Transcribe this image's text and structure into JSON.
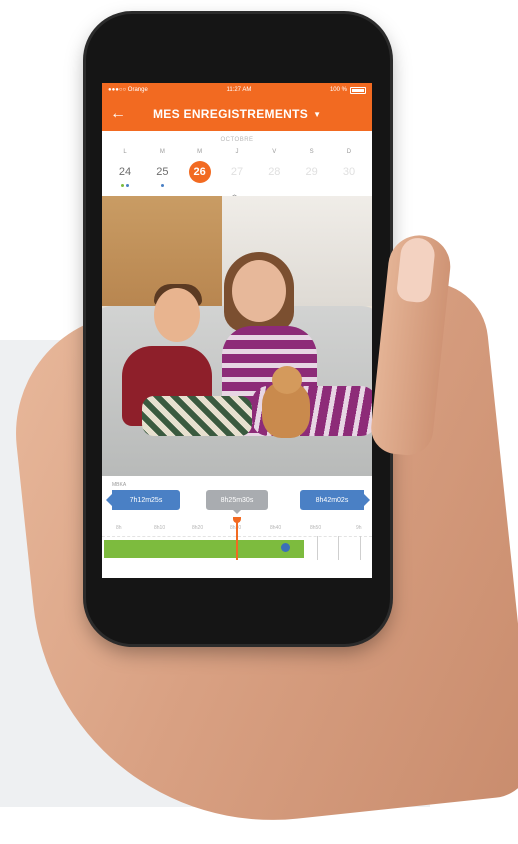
{
  "status_bar": {
    "carrier": "●●●○○ Orange",
    "time": "11:27 AM",
    "battery": "100 %"
  },
  "header": {
    "back_icon": "arrow-left-icon",
    "title": "MES ENREGISTREMENTS",
    "dropdown_icon": "caret-down-icon"
  },
  "calendar": {
    "month": "OCTOBRE",
    "days": [
      {
        "name": "L",
        "num": "24",
        "state": "normal",
        "dots": [
          "#7dbb3e",
          "#4a80c5"
        ]
      },
      {
        "name": "M",
        "num": "25",
        "state": "normal",
        "dots": [
          "#4a80c5"
        ]
      },
      {
        "name": "M",
        "num": "26",
        "state": "selected",
        "dots": []
      },
      {
        "name": "J",
        "num": "27",
        "state": "faded",
        "dots": []
      },
      {
        "name": "V",
        "num": "28",
        "state": "faded",
        "dots": []
      },
      {
        "name": "S",
        "num": "29",
        "state": "faded",
        "dots": []
      },
      {
        "name": "D",
        "num": "30",
        "state": "faded",
        "dots": []
      }
    ],
    "expand_icon": "chevron-down-icon"
  },
  "timeline": {
    "label": "MBKA",
    "prev_event": "7h12m25s",
    "current_time": "8h25m30s",
    "next_event": "8h42m02s",
    "ticks": [
      "8h",
      "8h10",
      "8h20",
      "8h30",
      "8h40",
      "8h50",
      "9h"
    ]
  },
  "colors": {
    "accent": "#f26a21",
    "chip_blue": "#4a80c5",
    "chip_gray": "#a9acb0",
    "recording_green": "#7dbb3e"
  }
}
